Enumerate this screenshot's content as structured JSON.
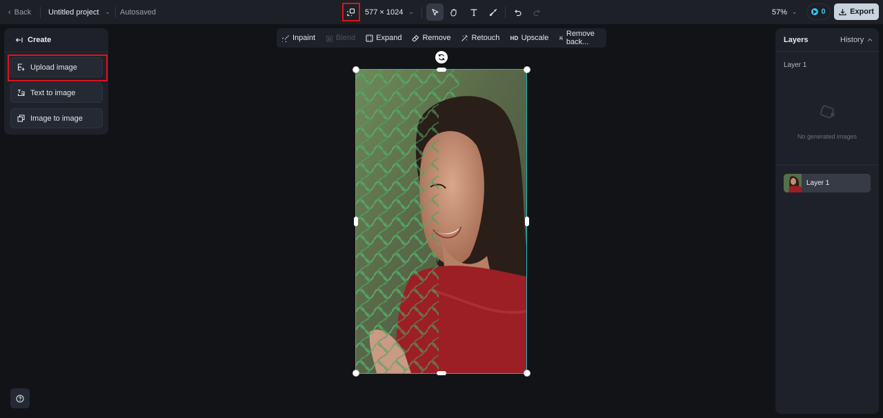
{
  "topbar": {
    "back_label": "Back",
    "project_title": "Untitled project",
    "save_status": "Autosaved",
    "canvas_size": "577 × 1024",
    "zoom_level": "57%",
    "credits": "0",
    "export_label": "Export",
    "tools": [
      {
        "name": "select",
        "icon": "cursor-arrow-icon",
        "active": true
      },
      {
        "name": "hand",
        "icon": "hand-icon",
        "active": false
      },
      {
        "name": "text",
        "icon": "text-icon",
        "active": false
      },
      {
        "name": "brush",
        "icon": "brush-icon",
        "active": false
      }
    ],
    "undo_enabled": true,
    "redo_enabled": false
  },
  "create_panel": {
    "title": "Create",
    "items": [
      {
        "label": "Upload image",
        "icon": "upload-image-icon",
        "highlighted": true
      },
      {
        "label": "Text to image",
        "icon": "text-to-image-icon"
      },
      {
        "label": "Image to image",
        "icon": "image-to-image-icon"
      }
    ]
  },
  "edit_toolbar": {
    "items": [
      {
        "label": "Inpaint",
        "icon": "inpaint-icon",
        "enabled": true
      },
      {
        "label": "Blend",
        "icon": "blend-icon",
        "enabled": false
      },
      {
        "label": "Expand",
        "icon": "expand-icon",
        "enabled": true
      },
      {
        "label": "Remove",
        "icon": "eraser-icon",
        "enabled": true
      },
      {
        "label": "Retouch",
        "icon": "magic-wand-icon",
        "enabled": true
      },
      {
        "label": "Upscale",
        "icon": "hd-icon",
        "icon_text": "HD",
        "enabled": true
      },
      {
        "label": "Remove back...",
        "icon": "remove-background-icon",
        "enabled": true
      }
    ]
  },
  "layers_panel": {
    "title": "Layers",
    "history_label": "History",
    "section_label": "Layer 1",
    "empty_text": "No generated images",
    "layers": [
      {
        "name": "Layer 1",
        "selected": true
      }
    ]
  },
  "colors": {
    "accent_selection": "#1ab9c4",
    "highlight_box": "#e0121f",
    "credits_accent": "#39c6f2",
    "export_bg": "#c8d3dd"
  }
}
